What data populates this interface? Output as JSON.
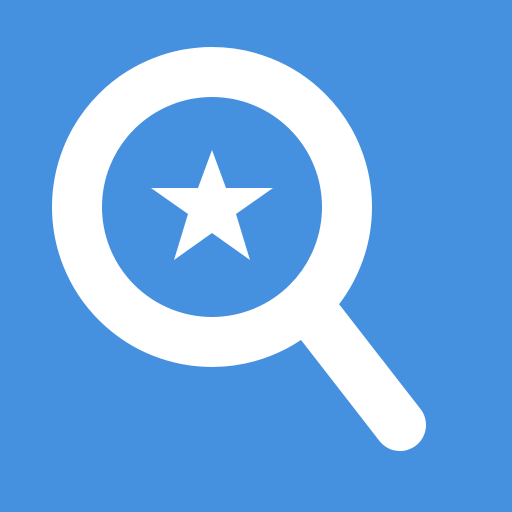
{
  "icon": {
    "semantic": "starred-search-icon",
    "background_color": "#4690E0",
    "foreground_color": "#FFFFFF",
    "parts": [
      "magnifier-icon",
      "star-icon"
    ]
  }
}
